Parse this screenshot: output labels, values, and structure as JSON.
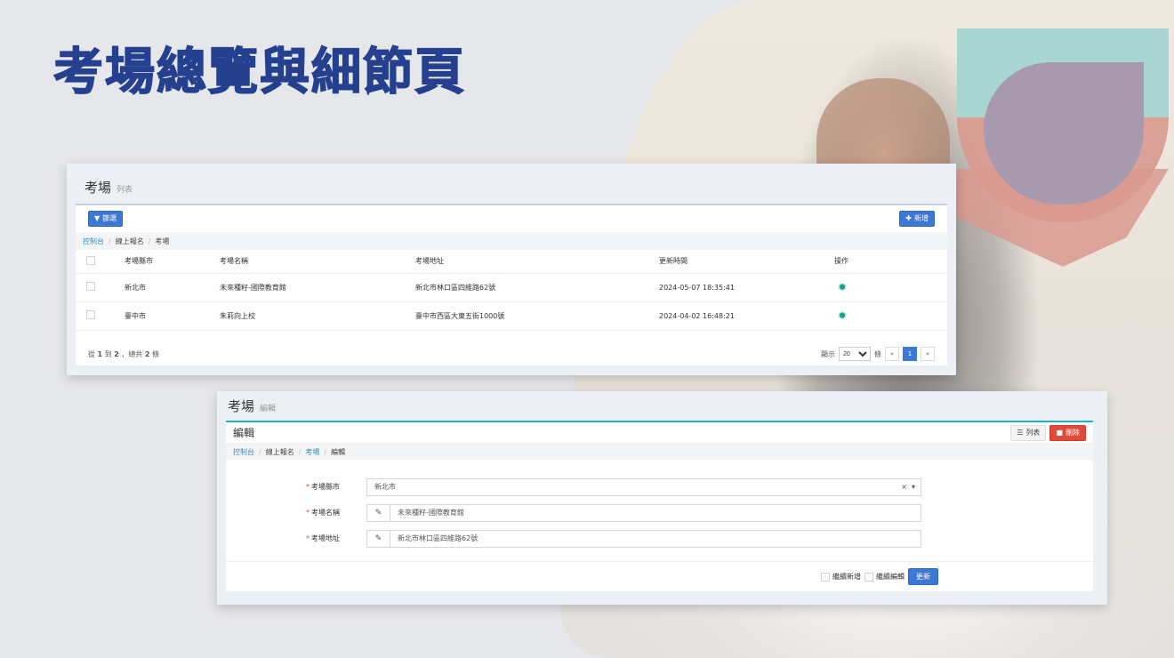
{
  "slide": {
    "title": "考場總覽與細節頁"
  },
  "list_view": {
    "heading": "考場",
    "subheading": "列表",
    "filter_button": "篩選",
    "add_button": "新增",
    "breadcrumb": [
      "控制台",
      "線上報名",
      "考場"
    ],
    "columns": [
      "考場縣市",
      "考場名稱",
      "考場地址",
      "更新時間",
      "操作"
    ],
    "rows": [
      {
        "city": "新北市",
        "name": "未來種籽-國際教育館",
        "address": "新北市林口區四維路62號",
        "updated": "2024-05-07 18:35:41"
      },
      {
        "city": "臺中市",
        "name": "朱莉向上校",
        "address": "臺中市西區大東五街1000號",
        "updated": "2024-04-02 16:48:21"
      }
    ],
    "footer": {
      "pre": "從",
      "from": "1",
      "mid": "到",
      "to": "2",
      "post": "，總共",
      "total": "2",
      "unit": "條"
    },
    "page_size_label": "顯示",
    "page_size": "20",
    "page_size_unit": "條",
    "pager": {
      "prev": "«",
      "current": "1",
      "next": "»"
    }
  },
  "edit_view": {
    "heading": "考場",
    "subheading": "編輯",
    "panel_title": "編輯",
    "list_button": "列表",
    "delete_button": "刪除",
    "breadcrumb": [
      "控制台",
      "線上報名",
      "考場",
      "編輯"
    ],
    "fields": [
      {
        "label": "考場縣市",
        "value": "新北市"
      },
      {
        "label": "考場名稱",
        "value": "未來種籽-國際教育館"
      },
      {
        "label": "考場地址",
        "value": "新北市林口區四維路62號"
      }
    ],
    "required_mark": "*",
    "clear_glyph": "×",
    "continue_add": "繼續新增",
    "continue_edit": "繼續編輯",
    "submit_button": "更新"
  },
  "icons": {
    "filter": "filter-icon",
    "plus": "plus-icon",
    "gear": "gear-icon",
    "list": "list-icon",
    "trash": "trash-icon",
    "pencil": "pencil-icon"
  },
  "colors": {
    "title": "#24408e",
    "primary": "#3c79d6",
    "danger": "#dd4b39",
    "gear": "#15a08a",
    "edit_box_accent": "#17b6cf"
  }
}
